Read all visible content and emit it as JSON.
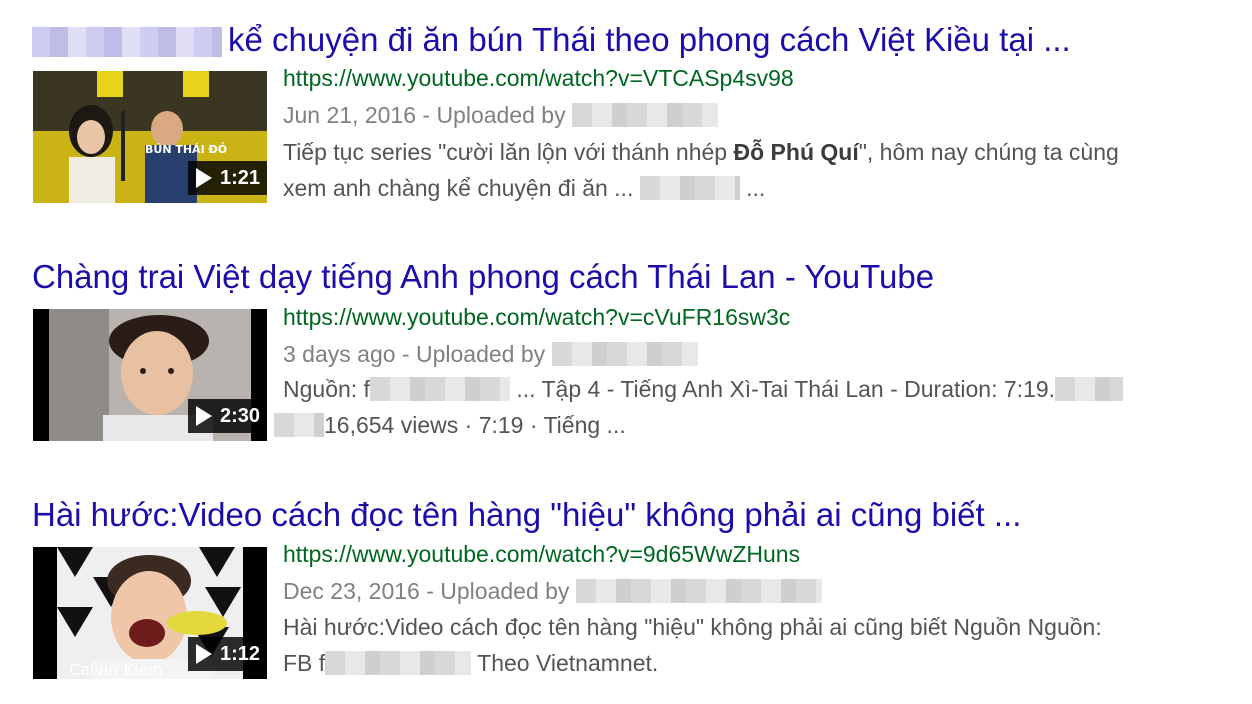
{
  "results": [
    {
      "title": "kể chuyện đi ăn bún Thái theo phong cách Việt Kiều tại ...",
      "url": "https://www.youtube.com/watch?v=VTCASp4sv98",
      "date_line": "Jun 21, 2016 - Uploaded by",
      "duration": "1:21",
      "snippet_1a": "Tiếp tục series \"cười lăn lộn với thánh nhép ",
      "snippet_1b": "Đỗ Phú Quí",
      "snippet_1c": "\", hôm nay chúng ta cùng",
      "snippet_2a": "xem anh chàng kể chuyện đi ăn ...",
      "snippet_2b": "...",
      "thumb_caption": "BÚN THÁI ĐỎ"
    },
    {
      "title": "Chàng trai Việt dạy tiếng Anh phong cách Thái Lan - YouTube",
      "url": "https://www.youtube.com/watch?v=cVuFR16sw3c",
      "date_line": "3 days ago - Uploaded by",
      "duration": "2:30",
      "snippet_1a": "Nguồn: f",
      "snippet_1b": "... Tập 4 - Tiếng Anh Xì-Tai Thái Lan - Duration: 7:19.",
      "snippet_2a": "16,654 views · 7:19 · Tiếng ..."
    },
    {
      "title": "Hài hước:Video cách đọc tên hàng \"hiệu\" không phải ai cũng biết ...",
      "url": "https://www.youtube.com/watch?v=9d65WwZHuns",
      "date_line": "Dec 23, 2016 - Uploaded by",
      "duration": "1:12",
      "snippet_1a": "Hài hước:Video cách đọc tên hàng \"hiệu\" không phải ai cũng biết Nguồn Nguồn:",
      "snippet_2a": "FB f",
      "snippet_2b": "Theo Vietnamnet.",
      "thumb_caption": "Calvin Klein"
    }
  ]
}
